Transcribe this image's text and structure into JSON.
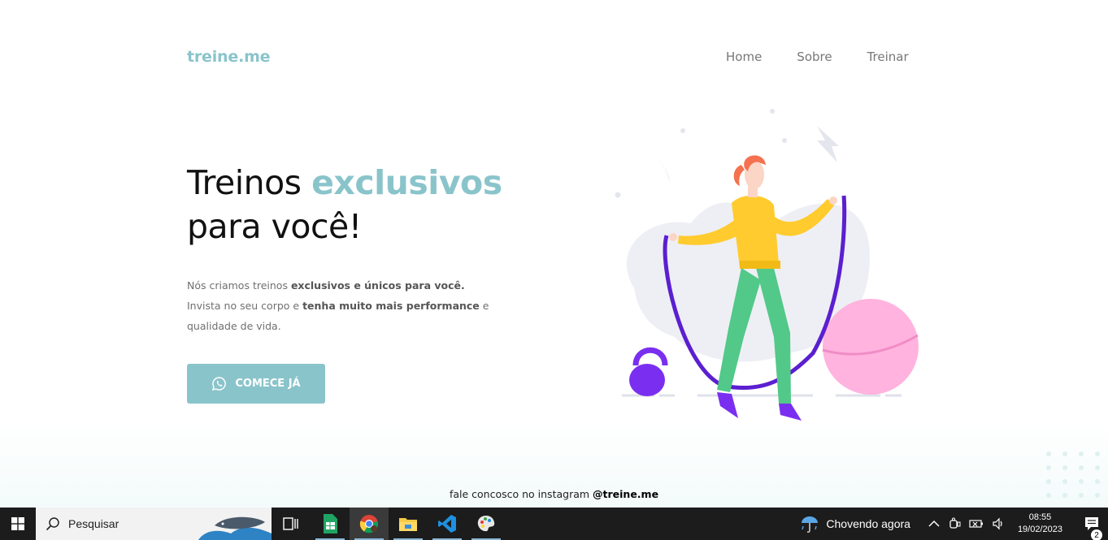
{
  "header": {
    "logo": "treine.me",
    "nav": [
      "Home",
      "Sobre",
      "Treinar"
    ]
  },
  "hero": {
    "headline_part1": "Treinos ",
    "headline_accent": "exclusivos",
    "headline_line2": "para você!",
    "desc": {
      "l1_plain": "Nós criamos treinos ",
      "l1_bold": "exclusivos e únicos para você.",
      "l2_plain": "Invista no seu corpo e ",
      "l2_bold": "tenha muito mais performance",
      "l2_end": " e",
      "l3": "qualidade de vida."
    },
    "cta_label": "COMECE JÁ"
  },
  "footer": {
    "note": "fale concosco no instagram ",
    "handle": "@treine.me"
  },
  "taskbar": {
    "search_placeholder": "Pesquisar",
    "weather": "Chovendo agora",
    "time": "08:55",
    "date": "19/02/2023",
    "notification_count": "2"
  },
  "colors": {
    "accent": "#8ac4cb",
    "taskbar": "#1c1c1c"
  },
  "icons": [
    "windows-start-icon",
    "search-icon",
    "task-view-icon",
    "sheets-icon",
    "chrome-icon",
    "file-explorer-icon",
    "vscode-icon",
    "paint-icon",
    "weather-icon",
    "chevron-up-icon",
    "meet-icon",
    "battery-icon",
    "volume-icon",
    "notification-icon",
    "whatsapp-icon"
  ]
}
